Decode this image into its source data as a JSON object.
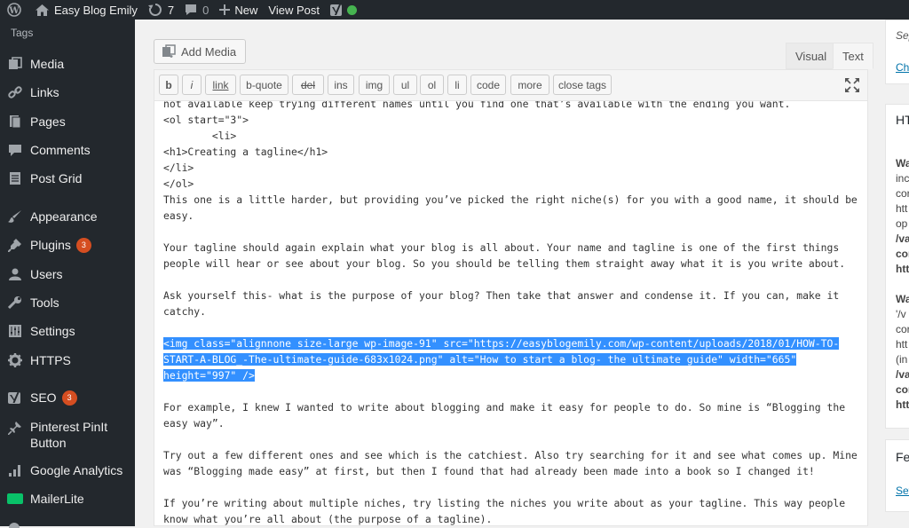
{
  "adminbar": {
    "site_name": "Easy Blog Emily",
    "updates_count": "7",
    "comments_count": "0",
    "new_label": "New",
    "view_post_label": "View Post"
  },
  "sidebar": {
    "current_sub": "Tags",
    "items": [
      {
        "label": "Media",
        "icon": "media-icon"
      },
      {
        "label": "Links",
        "icon": "links-icon"
      },
      {
        "label": "Pages",
        "icon": "pages-icon"
      },
      {
        "label": "Comments",
        "icon": "comments-icon"
      },
      {
        "label": "Post Grid",
        "icon": "post-grid-icon"
      },
      {
        "label": "Appearance",
        "icon": "appearance-icon"
      },
      {
        "label": "Plugins",
        "icon": "plugins-icon",
        "badge": "3"
      },
      {
        "label": "Users",
        "icon": "users-icon"
      },
      {
        "label": "Tools",
        "icon": "tools-icon"
      },
      {
        "label": "Settings",
        "icon": "settings-icon"
      },
      {
        "label": "HTTPS",
        "icon": "https-icon"
      },
      {
        "label": "SEO",
        "icon": "seo-icon",
        "badge": "3"
      },
      {
        "label": "Pinterest PinIt Button",
        "icon": "pinterest-icon"
      },
      {
        "label": "Google Analytics",
        "icon": "google-analytics-icon"
      },
      {
        "label": "MailerLite",
        "icon": "mailerlite-icon"
      }
    ]
  },
  "editor": {
    "add_media_label": "Add Media",
    "tab_visual": "Visual",
    "tab_text": "Text",
    "quicktags": [
      "b",
      "i",
      "link",
      "b-quote",
      "del",
      "ins",
      "img",
      "ul",
      "ol",
      "li",
      "code",
      "more",
      "close tags"
    ],
    "lines": [
      "not available keep trying different names until you find one that’s available with the ending you want.",
      "<ol start=\"3\">",
      "        <li>",
      "<h1>Creating a tagline</h1>",
      "</li>",
      "</ol>",
      "This one is a little harder, but providing you’ve picked the right niche(s) for you with a good name, it should be",
      "easy.",
      "",
      "Your tagline should again explain what your blog is all about. Your name and tagline is one of the first things",
      "people will hear or see about your blog. So you should be telling them straight away what it is you write about.",
      "",
      "Ask yourself this- what is the purpose of your blog? Then take that answer and condense it. If you can, make it",
      "catchy.",
      "",
      "<img class=\"alignnone size-large wp-image-91\" src=\"https://easyblogemily.com/wp-content/uploads/2018/01/HOW-TO-",
      "START-A-BLOG_-The-ultimate-guide-683x1024.png\" alt=\"How to start a blog- the ultimate guide\" width=\"665\"",
      "height=\"997\" />",
      "",
      "For example, I knew I wanted to write about blogging and make it easy for people to do. So mine is “Blogging the",
      "easy way”.",
      "",
      "Try out a few different ones and see which is the catchiest. Also try searching for it and see what comes up. Mine",
      "was “Blogging made easy” at first, but then I found that had already been made into a book so I changed it!",
      "",
      "If you’re writing about multiple niches, try listing the niches you write about as your tagline. This way people",
      "know what you’re all about (the purpose of a tagline)."
    ]
  },
  "right": {
    "box1": [
      "Sep",
      "Ch"
    ],
    "box2_title": "HT",
    "box2": [
      "Wa",
      "inc",
      "cor",
      "htt",
      "op",
      "/va",
      "cor",
      "htt",
      "",
      "Wa",
      "'/v",
      "cor",
      "htt",
      "(in",
      "/va",
      "cor",
      "htt"
    ],
    "box3_title": "Fea",
    "box3": [
      "Set"
    ]
  }
}
